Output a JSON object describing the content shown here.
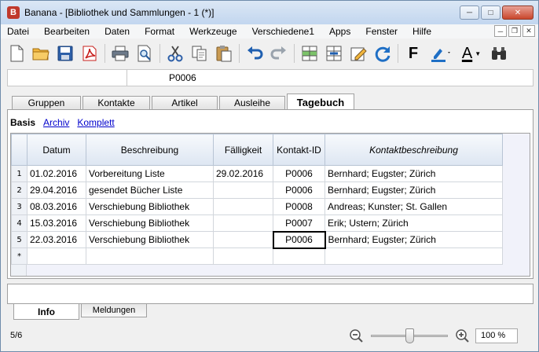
{
  "window": {
    "title": "Banana - [Bibliothek und Sammlungen - 1 (*)]",
    "app_icon_letter": "B"
  },
  "menu": [
    "Datei",
    "Bearbeiten",
    "Daten",
    "Format",
    "Werkzeuge",
    "Verschiedene1",
    "Apps",
    "Fenster",
    "Hilfe"
  ],
  "toolbar": {
    "icons": [
      "new-document-icon",
      "open-folder-icon",
      "save-icon",
      "pdf-icon",
      "print-icon",
      "print-preview-icon",
      "cut-icon",
      "copy-icon",
      "paste-icon",
      "undo-icon",
      "redo-icon",
      "insert-rows-icon",
      "delete-rows-icon",
      "edit-icon",
      "recalculate-icon",
      "bold-icon",
      "highlight-color-icon",
      "text-color-icon",
      "search-icon"
    ],
    "bold_label": "F",
    "text_color_label": "A",
    "accent_blue": "#1f6fc5",
    "text_color_bar": "#000000",
    "highlight_color_bar": "#1f6fc5"
  },
  "cellbar": {
    "content": "P0006"
  },
  "tabs": [
    {
      "label": "Gruppen",
      "active": false
    },
    {
      "label": "Kontakte",
      "active": false
    },
    {
      "label": "Artikel",
      "active": false
    },
    {
      "label": "Ausleihe",
      "active": false
    },
    {
      "label": "Tagebuch",
      "active": true
    }
  ],
  "views": {
    "active": "Basis",
    "links": [
      "Archiv",
      "Komplett"
    ]
  },
  "table": {
    "columns": [
      "Datum",
      "Beschreibung",
      "Fälligkeit",
      "Kontakt-ID",
      "Kontaktbeschreibung"
    ],
    "rows": [
      {
        "n": "1",
        "datum": "01.02.2016",
        "beschreibung": "Vorbereitung Liste",
        "faelligkeit": "29.02.2016",
        "kontakt_id": "P0006",
        "kontaktbeschreibung": "Bernhard; Eugster; Zürich"
      },
      {
        "n": "2",
        "datum": "29.04.2016",
        "beschreibung": "gesendet Bücher Liste",
        "faelligkeit": "",
        "kontakt_id": "P0006",
        "kontaktbeschreibung": "Bernhard; Eugster; Zürich"
      },
      {
        "n": "3",
        "datum": "08.03.2016",
        "beschreibung": "Verschiebung Bibliothek",
        "faelligkeit": "",
        "kontakt_id": "P0008",
        "kontaktbeschreibung": "Andreas; Kunster; St. Gallen"
      },
      {
        "n": "4",
        "datum": "15.03.2016",
        "beschreibung": "Verschiebung Bibliothek",
        "faelligkeit": "",
        "kontakt_id": "P0007",
        "kontaktbeschreibung": "Erik; Ustern; Zürich"
      },
      {
        "n": "5",
        "datum": "22.03.2016",
        "beschreibung": "Verschiebung Bibliothek",
        "faelligkeit": "",
        "kontakt_id": "P0006",
        "kontaktbeschreibung": "Bernhard; Eugster; Zürich"
      }
    ],
    "new_row_marker": "*"
  },
  "bottom_tabs": [
    {
      "label": "Info",
      "active": true
    },
    {
      "label": "Meldungen",
      "active": false
    }
  ],
  "status": {
    "row_info": "5/6",
    "zoom": "100 %",
    "zoom_level": 0.5
  }
}
